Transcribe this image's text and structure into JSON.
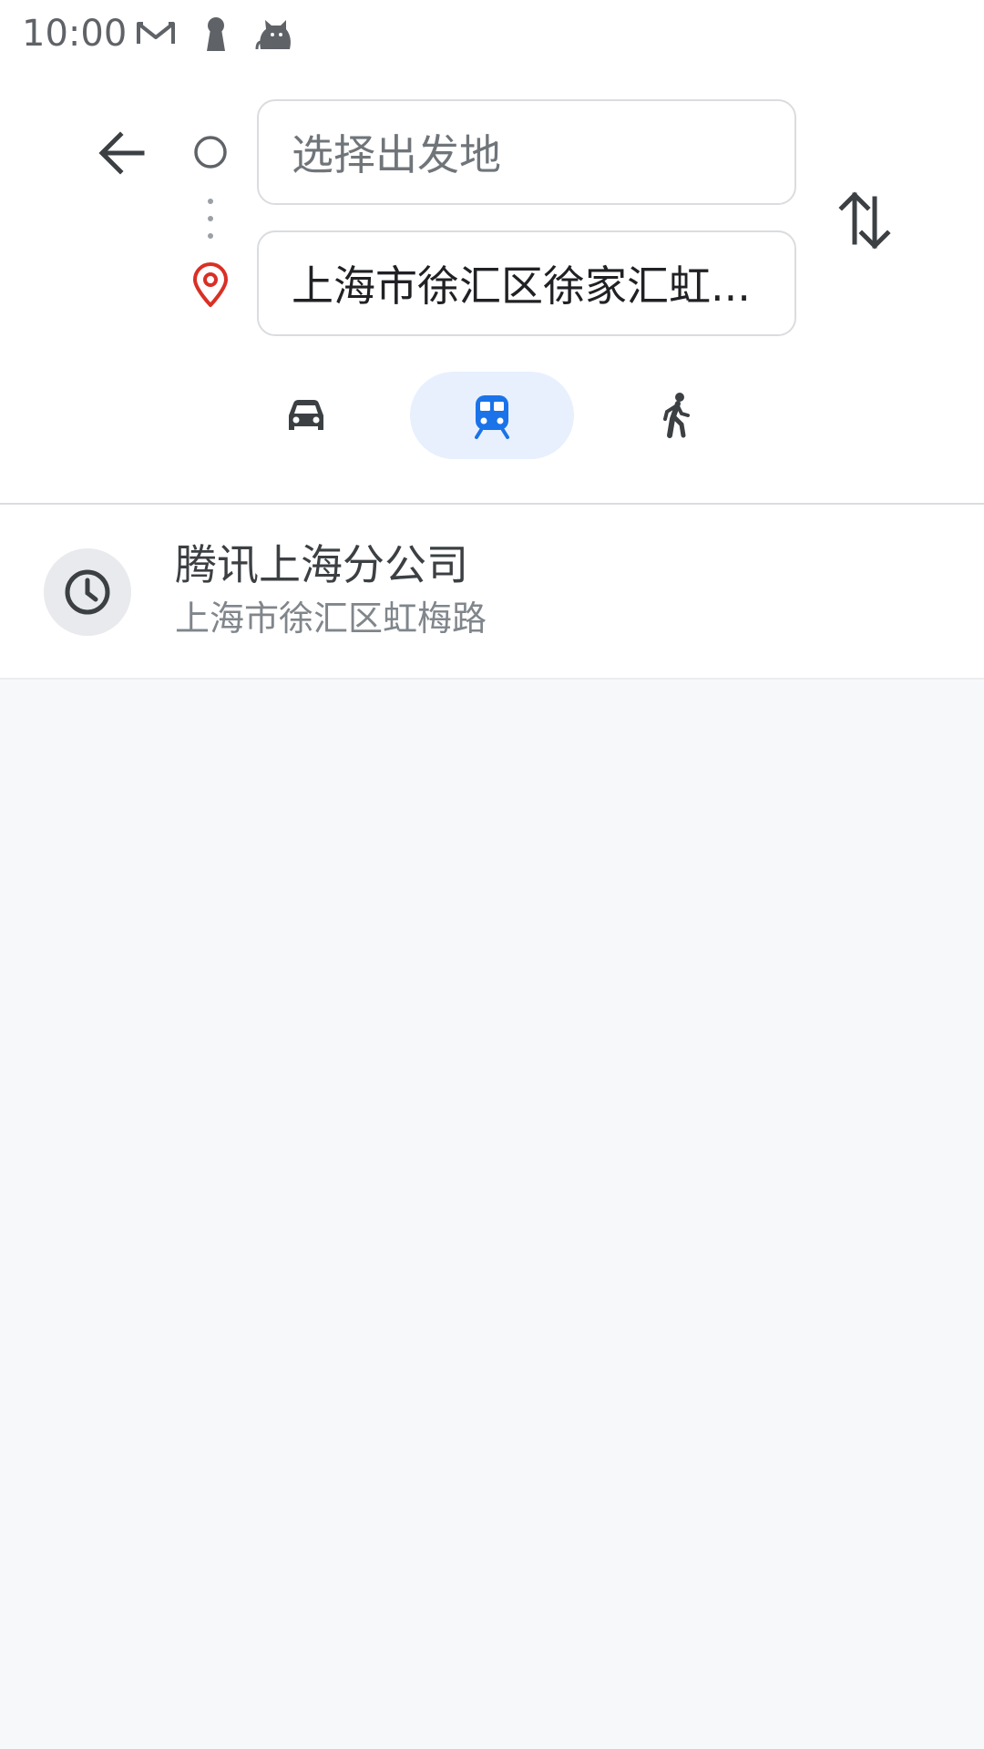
{
  "status_bar": {
    "time": "10:00",
    "icons": [
      "gmail-icon",
      "keyhole-icon",
      "cat-icon"
    ]
  },
  "header": {
    "back_icon": "arrow-left-icon",
    "origin": {
      "placeholder": "选择出发地",
      "value": ""
    },
    "destination": {
      "value": "上海市徐汇区徐家汇虹..."
    },
    "swap_icon": "swap-vertical-icon"
  },
  "modes": {
    "items": [
      {
        "name": "driving",
        "icon": "car-icon",
        "selected": false
      },
      {
        "name": "transit",
        "icon": "train-icon",
        "selected": true
      },
      {
        "name": "walking",
        "icon": "walk-icon",
        "selected": false
      }
    ]
  },
  "history": {
    "items": [
      {
        "icon": "clock-icon",
        "title": "腾讯上海分公司",
        "subtitle": "上海市徐汇区虹梅路"
      }
    ]
  },
  "colors": {
    "accent": "#1a73e8",
    "accent_bg": "#e8f0fe",
    "pin": "#d93025",
    "icon_dark": "#3c4043",
    "border": "#dadce0",
    "results_bg": "#f7f8fa"
  }
}
